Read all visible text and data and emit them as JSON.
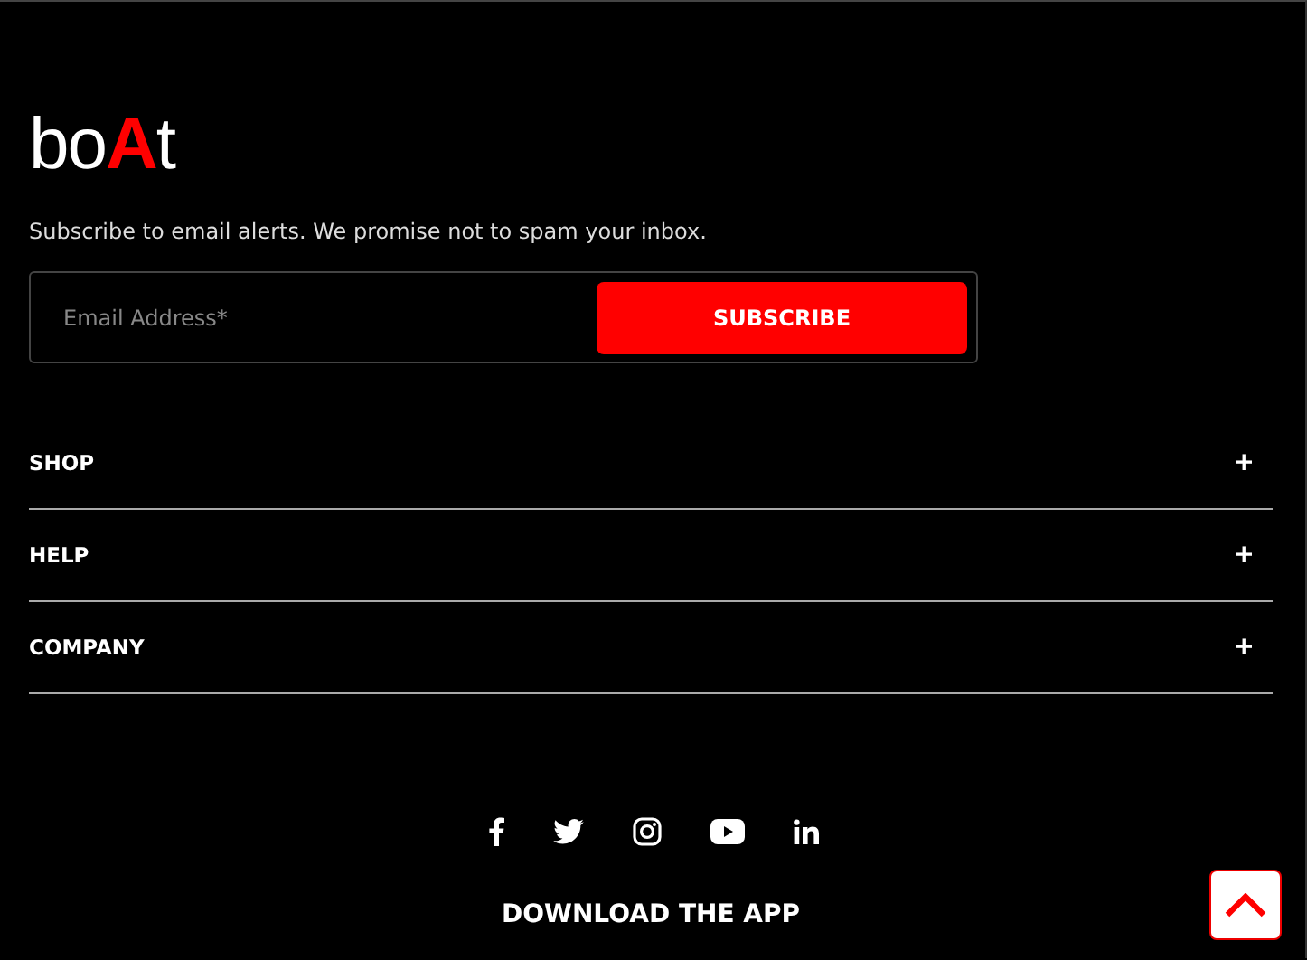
{
  "logo": {
    "parts": [
      {
        "text": "bo",
        "color": "#ffffff"
      },
      {
        "text": "A",
        "color": "#ff0000"
      },
      {
        "text": "t",
        "color": "#ffffff"
      }
    ]
  },
  "newsletter": {
    "text": "Subscribe to email alerts. We promise not to spam your inbox.",
    "email_placeholder": "Email Address*",
    "button": "SUBSCRIBE"
  },
  "sections": [
    {
      "label": "SHOP",
      "toggle": "+"
    },
    {
      "label": "HELP",
      "toggle": "+"
    },
    {
      "label": "COMPANY",
      "toggle": "+"
    }
  ],
  "social": [
    {
      "kind": "facebook"
    },
    {
      "kind": "twitter"
    },
    {
      "kind": "instagram"
    },
    {
      "kind": "youtube"
    },
    {
      "kind": "linkedin"
    }
  ],
  "download_heading": "DOWNLOAD THE APP"
}
